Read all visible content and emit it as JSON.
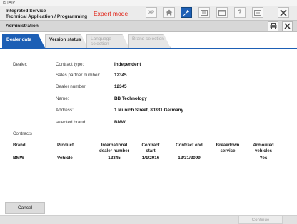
{
  "window": {
    "title": "ISTA/P"
  },
  "header": {
    "line1": "Integrated Service",
    "line2": "Technical Application / Programming",
    "mode": "Expert mode",
    "toolbar": [
      {
        "name": "xp-button",
        "label": "XP",
        "icon": "xp-icon",
        "active": false
      },
      {
        "name": "home-button",
        "label": "",
        "icon": "home-icon",
        "active": false
      },
      {
        "name": "tools-button",
        "label": "",
        "icon": "wrench-icon",
        "active": true
      },
      {
        "name": "list-button",
        "label": "",
        "icon": "list-icon",
        "active": false
      },
      {
        "name": "window-button",
        "label": "",
        "icon": "window-icon",
        "active": false
      },
      {
        "name": "help-button",
        "label": "",
        "icon": "help-icon",
        "active": false
      },
      {
        "name": "info-button",
        "label": "",
        "icon": "info-icon",
        "active": false
      },
      {
        "name": "close-app-button",
        "label": "",
        "icon": "close-icon",
        "active": false
      }
    ]
  },
  "subheader": {
    "title": "Administration"
  },
  "tabs": [
    {
      "label": "Dealer data",
      "state": "active"
    },
    {
      "label": "Version status",
      "state": "normal"
    },
    {
      "label": "Language selection",
      "state": "disabled"
    },
    {
      "label": "Brand selection",
      "state": "disabled"
    }
  ],
  "dealer": {
    "section_label": "Dealer:",
    "fields": [
      {
        "label": "Contract type:",
        "value": "Independent"
      },
      {
        "label": "Sales partner number:",
        "value": "12345"
      },
      {
        "label": "Dealer number:",
        "value": "12345"
      },
      {
        "label": "Name:",
        "value": "BB Technology"
      },
      {
        "label": "Address:",
        "value": "1 Munich Street, 80331 Germany"
      },
      {
        "label": "selected brand:",
        "value": "BMW"
      }
    ]
  },
  "contracts": {
    "section_label": "Contracts",
    "columns": [
      "Brand",
      "Product",
      "International dealer number",
      "Contract start",
      "Contract end",
      "Breakdown service",
      "Armoured vehicles"
    ],
    "rows": [
      [
        "BMW",
        "Vehicle",
        "12345",
        "1/1/2016",
        "12/31/2099",
        "",
        "Yes"
      ]
    ]
  },
  "buttons": {
    "cancel": "Cancel",
    "continue": "Continue"
  },
  "colors": {
    "accent": "#1d5fb5",
    "mode": "#e0261a"
  }
}
